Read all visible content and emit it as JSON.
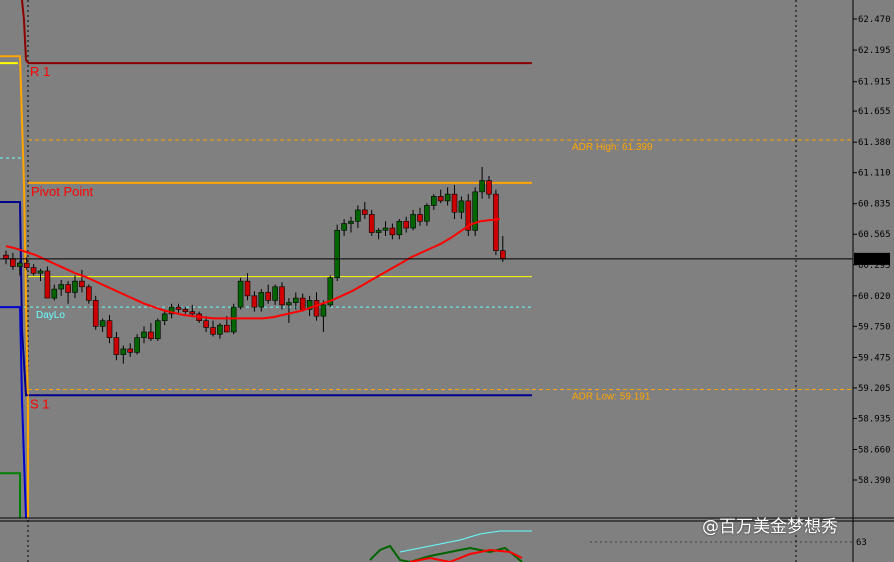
{
  "chart_data": {
    "type": "candlestick",
    "y_axis_ticks": [
      "62.470",
      "62.195",
      "61.915",
      "61.655",
      "61.380",
      "61.110",
      "60.835",
      "60.565",
      "60.295",
      "60.020",
      "59.750",
      "59.475",
      "59.205",
      "58.935",
      "58.660",
      "58.390"
    ],
    "y_range": [
      58.39,
      62.47
    ],
    "current_price": "60.347",
    "levels": {
      "r1": {
        "label": "R 1",
        "value": 62.08,
        "color": "#8b0000"
      },
      "pivot": {
        "label": "Pivot Point",
        "value": 61.02,
        "color": "#ffa500"
      },
      "s1": {
        "label": "S 1",
        "value": 59.14,
        "color": "#00008b"
      },
      "dayhi_line": {
        "value": 60.19,
        "color": "#ffff00"
      },
      "daylo": {
        "label": "DayLo",
        "value": 59.92,
        "color": "#66ffff"
      },
      "adr_high": {
        "label": "ADR High: 61.399",
        "value": 61.399,
        "color": "#ffa500"
      },
      "adr_low": {
        "label": "ADR Low: 59.191",
        "value": 59.191,
        "color": "#ffa500"
      }
    },
    "candles": [
      [
        60.38,
        60.42,
        60.3,
        60.35
      ],
      [
        60.35,
        60.4,
        60.25,
        60.28
      ],
      [
        60.28,
        60.33,
        60.2,
        60.31
      ],
      [
        60.31,
        60.36,
        60.25,
        60.27
      ],
      [
        60.27,
        60.3,
        60.2,
        60.22
      ],
      [
        60.22,
        60.26,
        60.15,
        60.24
      ],
      [
        60.24,
        60.28,
        60.05,
        60.0
      ],
      [
        60.0,
        60.12,
        59.98,
        60.08
      ],
      [
        60.08,
        60.16,
        60.02,
        60.12
      ],
      [
        60.12,
        60.15,
        59.95,
        60.05
      ],
      [
        60.05,
        60.2,
        60.0,
        60.15
      ],
      [
        60.15,
        60.25,
        60.05,
        60.1
      ],
      [
        60.1,
        60.12,
        59.95,
        59.98
      ],
      [
        59.98,
        60.02,
        59.72,
        59.75
      ],
      [
        59.75,
        59.82,
        59.7,
        59.8
      ],
      [
        59.8,
        59.85,
        59.6,
        59.65
      ],
      [
        59.65,
        59.7,
        59.45,
        59.5
      ],
      [
        59.5,
        59.58,
        59.42,
        59.55
      ],
      [
        59.55,
        59.6,
        59.48,
        59.52
      ],
      [
        59.52,
        59.68,
        59.5,
        59.65
      ],
      [
        59.65,
        59.75,
        59.6,
        59.7
      ],
      [
        59.7,
        59.78,
        59.62,
        59.64
      ],
      [
        59.64,
        59.82,
        59.62,
        59.8
      ],
      [
        59.8,
        59.9,
        59.76,
        59.86
      ],
      [
        59.86,
        59.95,
        59.82,
        59.92
      ],
      [
        59.92,
        59.95,
        59.85,
        59.9
      ],
      [
        59.9,
        59.92,
        59.86,
        59.88
      ],
      [
        59.88,
        59.94,
        59.84,
        59.86
      ],
      [
        59.86,
        59.88,
        59.78,
        59.8
      ],
      [
        59.8,
        59.84,
        59.7,
        59.74
      ],
      [
        59.74,
        59.8,
        59.66,
        59.68
      ],
      [
        59.68,
        59.78,
        59.64,
        59.76
      ],
      [
        59.76,
        59.84,
        59.72,
        59.7
      ],
      [
        59.7,
        59.95,
        59.68,
        59.92
      ],
      [
        59.92,
        60.18,
        59.9,
        60.15
      ],
      [
        60.15,
        60.22,
        59.98,
        60.02
      ],
      [
        60.02,
        60.06,
        59.88,
        59.92
      ],
      [
        59.92,
        60.08,
        59.88,
        60.05
      ],
      [
        60.05,
        60.12,
        59.95,
        59.98
      ],
      [
        59.98,
        60.12,
        59.94,
        60.1
      ],
      [
        60.1,
        60.14,
        59.9,
        59.94
      ],
      [
        59.94,
        60.0,
        59.78,
        59.96
      ],
      [
        59.96,
        60.05,
        59.9,
        60.0
      ],
      [
        60.0,
        60.04,
        59.88,
        59.9
      ],
      [
        59.9,
        60.02,
        59.84,
        59.98
      ],
      [
        59.98,
        60.05,
        59.8,
        59.84
      ],
      [
        59.84,
        59.98,
        59.7,
        59.94
      ],
      [
        59.94,
        60.2,
        59.92,
        60.18
      ],
      [
        60.18,
        60.65,
        60.15,
        60.6
      ],
      [
        60.6,
        60.7,
        60.55,
        60.66
      ],
      [
        60.66,
        60.72,
        60.58,
        60.68
      ],
      [
        60.68,
        60.82,
        60.62,
        60.78
      ],
      [
        60.78,
        60.85,
        60.7,
        60.74
      ],
      [
        60.74,
        60.78,
        60.55,
        60.58
      ],
      [
        60.58,
        60.62,
        60.52,
        60.6
      ],
      [
        60.6,
        60.68,
        60.55,
        60.62
      ],
      [
        60.62,
        60.66,
        60.52,
        60.56
      ],
      [
        60.56,
        60.7,
        60.52,
        60.68
      ],
      [
        60.68,
        60.72,
        60.58,
        60.62
      ],
      [
        60.62,
        60.78,
        60.6,
        60.74
      ],
      [
        60.74,
        60.8,
        60.64,
        60.68
      ],
      [
        60.68,
        60.84,
        60.64,
        60.82
      ],
      [
        60.82,
        60.92,
        60.78,
        60.9
      ],
      [
        60.9,
        60.96,
        60.84,
        60.86
      ],
      [
        60.86,
        60.98,
        60.82,
        60.92
      ],
      [
        60.92,
        61.0,
        60.7,
        60.76
      ],
      [
        60.76,
        60.9,
        60.7,
        60.86
      ],
      [
        60.86,
        60.92,
        60.55,
        60.6
      ],
      [
        60.6,
        60.98,
        60.55,
        60.94
      ],
      [
        60.94,
        61.16,
        60.88,
        61.04
      ],
      [
        61.04,
        61.08,
        60.88,
        60.92
      ],
      [
        60.92,
        60.96,
        60.38,
        60.42
      ],
      [
        60.42,
        60.55,
        60.32,
        60.35
      ]
    ],
    "ma_values": [
      60.46,
      60.44,
      60.41,
      60.38,
      60.34,
      60.3,
      60.26,
      60.22,
      60.19,
      60.15,
      60.11,
      60.07,
      60.03,
      59.99,
      59.95,
      59.92,
      59.89,
      59.87,
      59.85,
      59.84,
      59.83,
      59.82,
      59.82,
      59.82,
      59.82,
      59.82,
      59.82,
      59.83,
      59.85,
      59.87,
      59.89,
      59.92,
      59.95,
      59.98,
      60.02,
      60.06,
      60.11,
      60.16,
      60.21,
      60.26,
      60.31,
      60.36,
      60.4,
      60.44,
      60.48,
      60.53,
      60.59,
      60.65,
      60.68,
      60.69,
      60.7
    ]
  },
  "watermark": "百万美金梦想秀",
  "watermark_prefix": "@"
}
